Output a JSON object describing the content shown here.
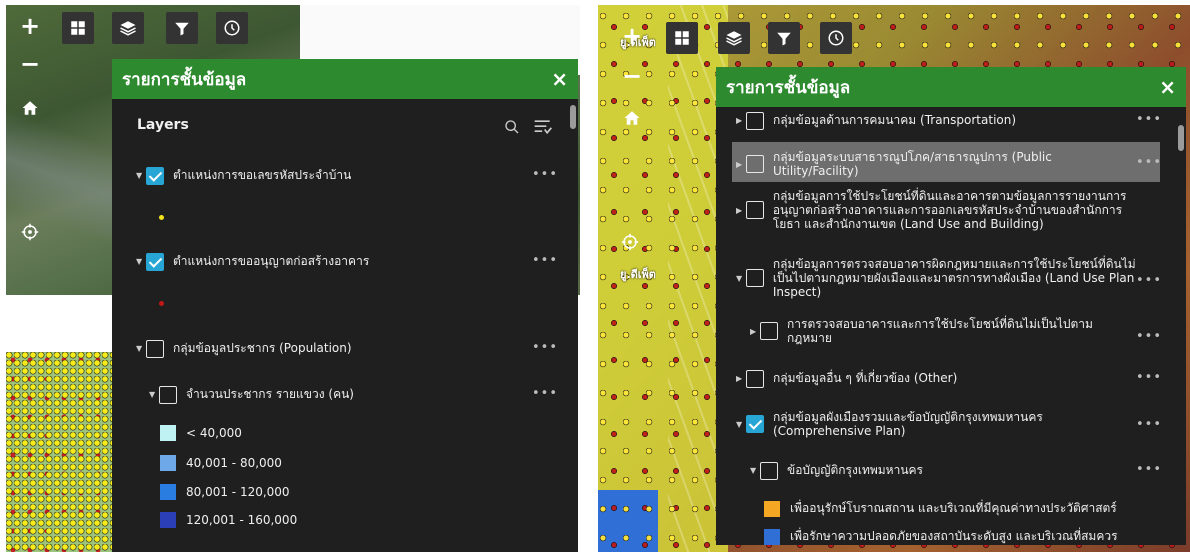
{
  "left": {
    "panel": {
      "title": "รายการชั้นข้อมูล",
      "close": "×",
      "layers_heading": "Layers",
      "items": [
        {
          "label": "ตำแหน่งการขอเลขรหัสประจำบ้าน",
          "checked": true,
          "marker": "#f4e31b"
        },
        {
          "label": "ตำแหน่งการขออนุญาตก่อสร้างอาคาร",
          "checked": true,
          "marker": "#c01818"
        },
        {
          "label": "กลุ่มข้อมูลประชากร (Population)",
          "checked": false
        },
        {
          "label": "จำนวนประชากร รายแขวง (คน)",
          "checked": false
        }
      ],
      "legend": [
        {
          "label": "< 40,000",
          "color": "#bff3f3"
        },
        {
          "label": "40,001 - 80,000",
          "color": "#6fa8e8"
        },
        {
          "label": "80,001 - 120,000",
          "color": "#2a7de0"
        },
        {
          "label": "120,001 - 160,000",
          "color": "#2a3fb8"
        }
      ]
    }
  },
  "right": {
    "map_labels": [
      "ยู.ดีเพ็ต",
      "ยู.ดีเพ็ต"
    ],
    "panel": {
      "title": "รายการชั้นข้อมูล",
      "close": "×",
      "items": [
        {
          "label": "กลุ่มข้อมูลด้านการคมนาคม (Transportation)",
          "checked": false
        },
        {
          "label": "กลุ่มข้อมูลระบบสาธารณูปโภค/สาธารณูปการ (Public Utility/Facility)",
          "checked": false,
          "highlight": true
        },
        {
          "label": "กลุ่มข้อมูลการใช้ประโยชน์ที่ดินและอาคารตามข้อมูลการรายงานการอนุญาตก่อสร้างอาคารและการออกเลขรหัสประจำบ้านของสำนักการโยธา และสำนักงานเขต (Land Use and Building)",
          "checked": false
        },
        {
          "label": "กลุ่มข้อมูลการตรวจสอบอาคารผิดกฎหมายและการใช้ประโยชน์ที่ดินไม่เป็นไปตามกฎหมายผังเมืองและมาตรการทางผังเมือง (Land Use Plan Inspect)",
          "checked": false
        },
        {
          "label": "การตรวจสอบอาคารและการใช้ประโยชน์ที่ดินไม่เป็นไปตามกฎหมาย",
          "checked": false
        },
        {
          "label": "กลุ่มข้อมูลอื่น ๆ ที่เกี่ยวข้อง (Other)",
          "checked": false
        },
        {
          "label": "กลุ่มข้อมูลผังเมืองรวมและข้อบัญญัติกรุงเทพมหานคร (Comprehensive Plan)",
          "checked": true
        },
        {
          "label": "ข้อบัญญัติกรุงเทพมหานคร",
          "checked": false
        }
      ],
      "legend": [
        {
          "label": "เพื่ออนุรักษ์โบราณสถาน และบริเวณที่มีคุณค่าทางประวัติศาสตร์",
          "color": "#f5a623"
        },
        {
          "label": "เพื่อรักษาความปลอดภัยของสถาบันระดับสูง และบริเวณที่สมควร",
          "color": "#2f6fd6"
        }
      ]
    }
  },
  "common": {
    "more": "•••",
    "plus": "+",
    "minus": "−"
  }
}
